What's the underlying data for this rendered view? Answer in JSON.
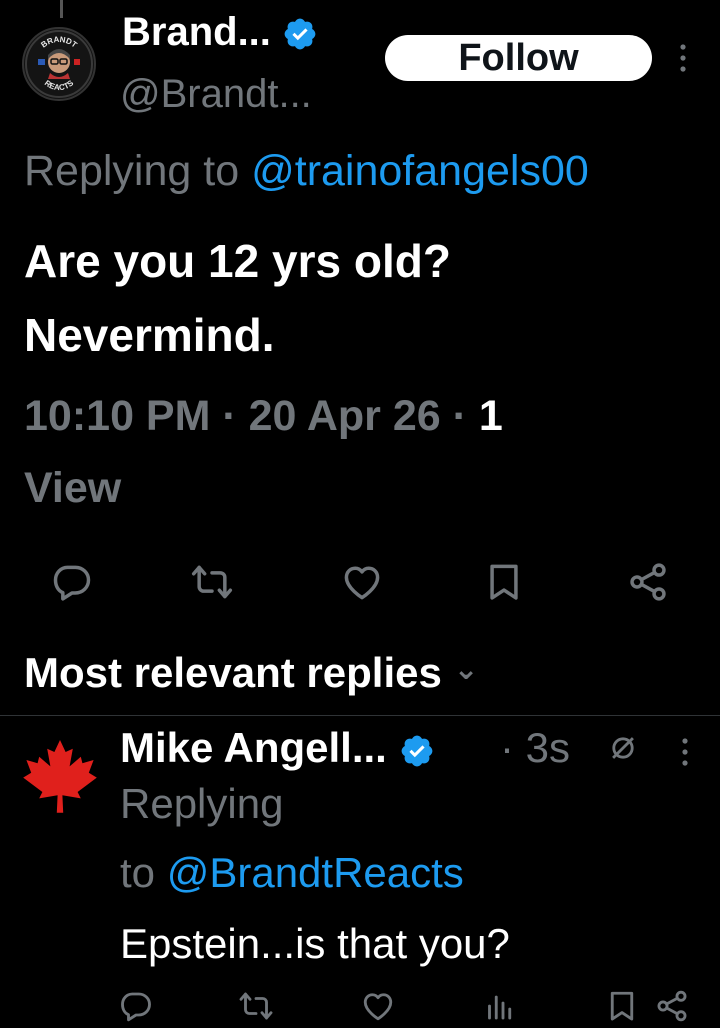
{
  "tweet": {
    "author_name": "Brand...",
    "author_handle": "@Brandt...",
    "follow_label": "Follow",
    "replying_label": "Replying to",
    "replying_handle": "@trainofangels00",
    "text_line1": "Are you 12 yrs old?",
    "text_line2": "Nevermind.",
    "timestamp": "10:10 PM · 20 Apr 26 · ",
    "views_count": "1",
    "views_label": "View",
    "avatar_text_top": "BRANDT",
    "avatar_text_bottom": "REACTS"
  },
  "replies_section": {
    "title": "Most relevant replies",
    "chevron": "⌄"
  },
  "reply": {
    "author_name": "Mike Angell...",
    "time": "· 3s",
    "replying_label": "Replying",
    "replying_to_label": "to",
    "replying_handle": "@BrandtReacts",
    "text": "Epstein...is that you?"
  },
  "colors": {
    "background": "#000000",
    "text": "#e7e9ea",
    "muted": "#71767b",
    "accent": "#1d9bf0",
    "maple_leaf": "#e0201c"
  },
  "icons": {
    "tweet_actions": [
      "reply-icon",
      "retweet-icon",
      "like-icon",
      "bookmark-icon",
      "share-icon"
    ],
    "reply_actions": [
      "reply-icon",
      "retweet-icon",
      "like-icon",
      "views-icon",
      "bookmark-icon",
      "share-icon"
    ],
    "verified": "verified-badge-icon",
    "more": "more-options-icon",
    "muted": "muted-icon"
  }
}
